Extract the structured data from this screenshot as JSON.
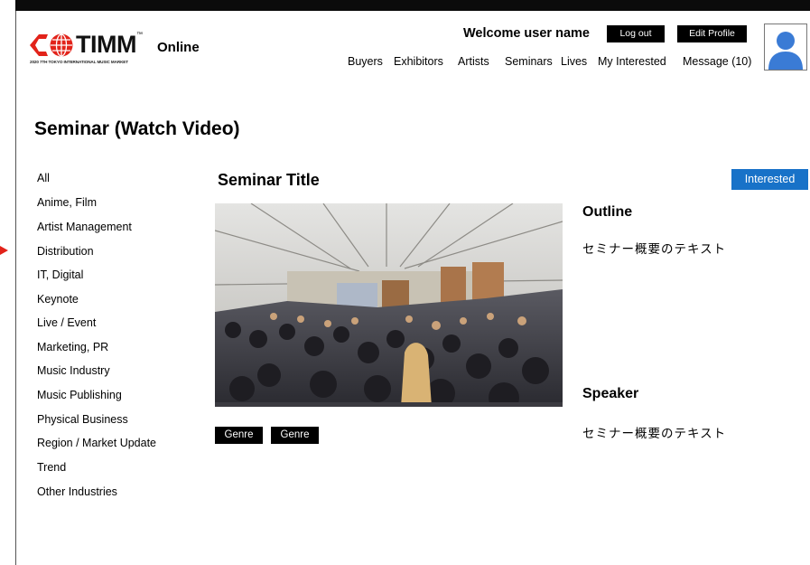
{
  "header": {
    "logo_text": "TIMM",
    "logo_tm": "™",
    "logo_sub": "2020 7TH TOKYO INTERNATIONAL MUSIC MARKET",
    "online_label": "Online",
    "welcome": "Welcome user name",
    "logout_label": "Log out",
    "edit_profile_label": "Edit Profile",
    "nav": [
      "Buyers",
      "Exhibitors",
      "Artists",
      "Seminars",
      "Lives",
      "My Interested",
      "Message (10)"
    ]
  },
  "page_title": "Seminar (Watch Video)",
  "categories": [
    "All",
    "Anime, Film",
    "Artist Management",
    "Distribution",
    "IT, Digital",
    "Keynote",
    "Live / Event",
    "Marketing, PR",
    "Music Industry",
    "Music Publishing",
    "Physical Business",
    "Region / Market Update",
    "Trend",
    "Other Industries"
  ],
  "seminar": {
    "title": "Seminar Title",
    "interested_label": "Interested",
    "genres": [
      "Genre",
      "Genre"
    ],
    "outline_heading": "Outline",
    "outline_text": "セミナー概要のテキスト",
    "speaker_heading": "Speaker",
    "speaker_text": "セミナー概要のテキスト"
  },
  "colors": {
    "accent_blue": "#1872c8",
    "arrow_red": "#e2231a",
    "logo_red": "#e2231a",
    "avatar_blue": "#3a7bd5"
  },
  "icons": {
    "avatar": "user-avatar-icon",
    "logo_mark": "globe-logo-icon",
    "selection_marker": "arrow-right-icon"
  }
}
